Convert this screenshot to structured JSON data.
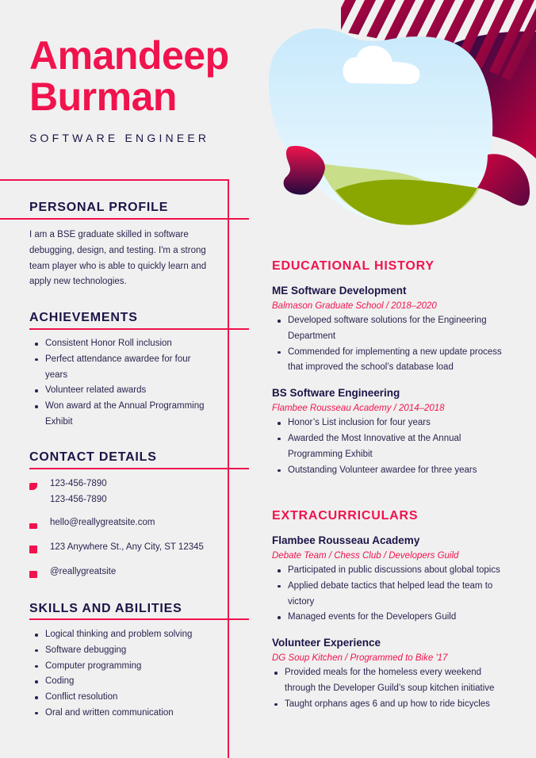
{
  "header": {
    "first_name": "Amandeep",
    "last_name": "Burman",
    "title": "SOFTWARE ENGINEER"
  },
  "profile": {
    "heading": "PERSONAL PROFILE",
    "text": "I am a BSE graduate skilled in software debugging, design, and testing. I'm a strong team player who is able to quickly learn and apply new technologies."
  },
  "achievements": {
    "heading": "ACHIEVEMENTS",
    "items": [
      "Consistent Honor Roll inclusion",
      "Perfect attendance awardee for four years",
      "Volunteer related awards",
      "Won award at the Annual Programming Exhibit"
    ]
  },
  "contact": {
    "heading": "CONTACT DETAILS",
    "phone1": "123-456-7890",
    "phone2": "123-456-7890",
    "email": "hello@reallygreatsite.com",
    "address": "123 Anywhere St., Any City, ST 12345",
    "social": "@reallygreatsite",
    "icons": [
      "phone-icon",
      "mail-icon",
      "home-icon",
      "linkedin-icon"
    ]
  },
  "skills": {
    "heading": "SKILLS AND ABILITIES",
    "items": [
      "Logical thinking and problem solving",
      "Software debugging",
      "Computer programming",
      "Coding",
      "Conflict resolution",
      "Oral and written communication"
    ]
  },
  "education": {
    "heading": "EDUCATIONAL HISTORY",
    "entries": [
      {
        "degree": "ME Software Development",
        "school": "Balmason Graduate School / 2018–2020",
        "items": [
          "Developed software solutions for the Engineering Department",
          "Commended for implementing a new update process that improved the school’s database load"
        ]
      },
      {
        "degree": "BS Software Engineering",
        "school": "Flambee Rousseau Academy / 2014–2018",
        "items": [
          "Honor’s List inclusion for four years",
          "Awarded the Most Innovative at the Annual Programming Exhibit",
          "Outstanding Volunteer awardee for three years"
        ]
      }
    ]
  },
  "extracurriculars": {
    "heading": "EXTRACURRICULARS",
    "entries": [
      {
        "title": "Flambee Rousseau Academy",
        "sub": "Debate Team / Chess Club / Developers Guild",
        "items": [
          "Participated in public discussions about global topics",
          "Applied debate tactics that helped lead the team to victory",
          "Managed events for the Developers Guild"
        ]
      },
      {
        "title": "Volunteer Experience",
        "sub": "DG Soup Kitchen / Programmed to Bike '17",
        "items": [
          "Provided meals for the homeless every weekend through the Developer Guild’s soup kitchen initiative",
          "Taught orphans ages 6 and up how to ride bicycles"
        ]
      }
    ]
  },
  "colors": {
    "accent": "#f0134d",
    "navy": "#1b1547",
    "background": "#f0f0f0"
  }
}
